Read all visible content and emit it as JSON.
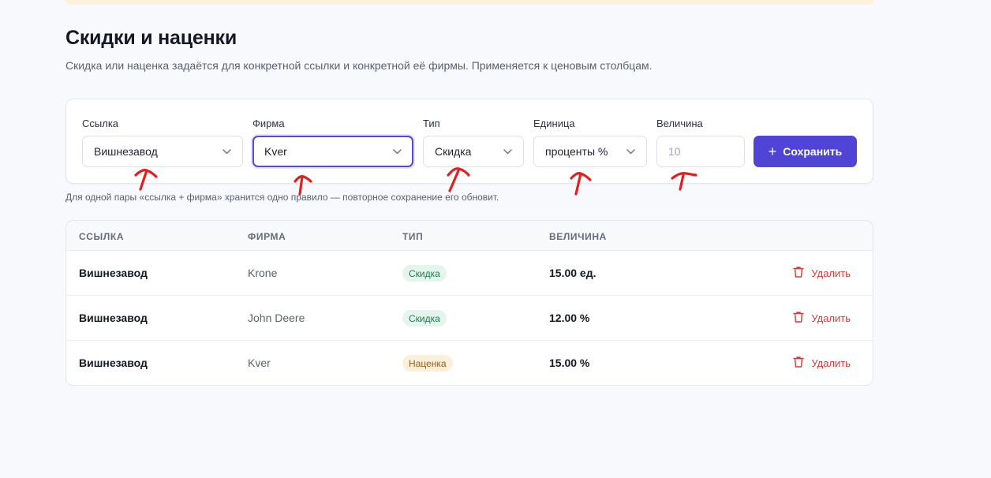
{
  "page": {
    "title": "Скидки и наценки",
    "subtitle": "Скидка или наценка задаётся для конкретной ссылки и конкретной её фирмы. Применяется к ценовым столбцам."
  },
  "form": {
    "link": {
      "label": "Ссылка",
      "value": "Вишнезавод"
    },
    "firm": {
      "label": "Фирма",
      "value": "Kver"
    },
    "type": {
      "label": "Тип",
      "value": "Скидка"
    },
    "unit": {
      "label": "Единица",
      "value": "проценты %"
    },
    "amount": {
      "label": "Величина",
      "placeholder": "10"
    },
    "save_label": "Сохранить",
    "hint": "Для одной пары «ссылка + фирма» хранится одно правило — повторное сохранение его обновит."
  },
  "table": {
    "headers": {
      "link": "ССЫЛКА",
      "firm": "ФИРМА",
      "type": "ТИП",
      "amount": "ВЕЛИЧИНА"
    },
    "rows": [
      {
        "link": "Вишнезавод",
        "firm": "Krone",
        "type": "Скидка",
        "amount": "15.00 ед.",
        "delete": "Удалить"
      },
      {
        "link": "Вишнезавод",
        "firm": "John Deere",
        "type": "Скидка",
        "amount": "12.00 %",
        "delete": "Удалить"
      },
      {
        "link": "Вишнезавод",
        "firm": "Kver",
        "type": "Наценка",
        "amount": "15.00 %",
        "delete": "Удалить"
      }
    ]
  },
  "colors": {
    "accent": "#4f44d6",
    "danger": "#d63a3a",
    "discount_badge_bg": "#e3f5ec",
    "markup_badge_bg": "#fdf0db",
    "annotation_arrows": "#e02020"
  },
  "icons": [
    "chevron-down-icon",
    "plus-icon",
    "trash-icon",
    "annotation-arrow"
  ]
}
